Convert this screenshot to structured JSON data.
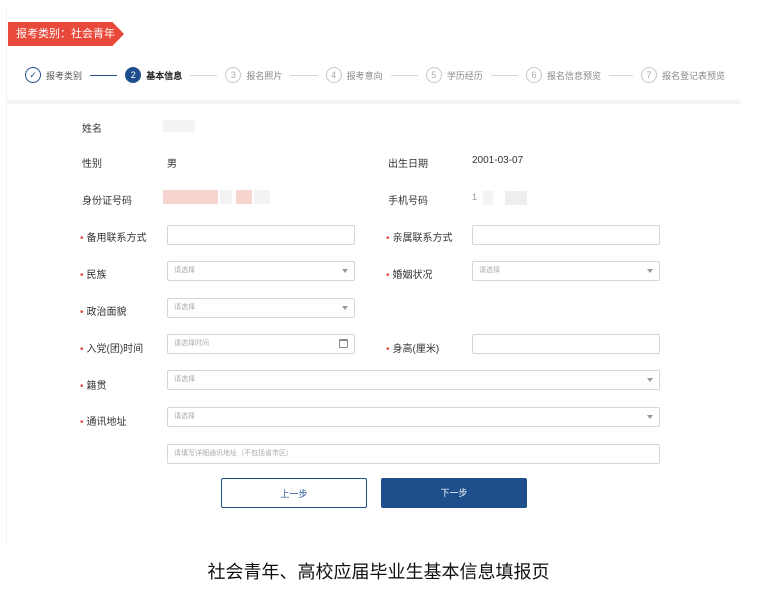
{
  "tag": "报考类别：社会青年",
  "steps": [
    {
      "num": "✓",
      "label": "报考类别"
    },
    {
      "num": "2",
      "label": "基本信息"
    },
    {
      "num": "3",
      "label": "报名照片"
    },
    {
      "num": "4",
      "label": "报考意向"
    },
    {
      "num": "5",
      "label": "学历经历"
    },
    {
      "num": "6",
      "label": "报名信息预览"
    },
    {
      "num": "7",
      "label": "报名登记表预览"
    }
  ],
  "form": {
    "name_label": "姓名",
    "gender_label": "性别",
    "gender_value": "男",
    "birth_label": "出生日期",
    "birth_value": "2001-03-07",
    "id_label": "身份证号码",
    "phone_label": "手机号码",
    "phone_value": "1",
    "backup_contact_label": "备用联系方式",
    "relative_contact_label": "亲属联系方式",
    "ethnicity_label": "民族",
    "ethnicity_placeholder": "请选择",
    "marital_label": "婚姻状况",
    "marital_placeholder": "请选择",
    "political_label": "政治面貌",
    "political_placeholder": "请选择",
    "party_date_label": "入党(团)时间",
    "party_date_placeholder": "请选择时间",
    "height_label": "身高(厘米)",
    "native_label": "籍贯",
    "native_placeholder": "请选择",
    "address_label": "通讯地址",
    "address_placeholder": "请选择",
    "address_detail_placeholder": "请填写详细通讯地址（不包括省市区）"
  },
  "buttons": {
    "prev": "上一步",
    "next": "下一步"
  },
  "caption": "社会青年、高校应届毕业生基本信息填报页"
}
